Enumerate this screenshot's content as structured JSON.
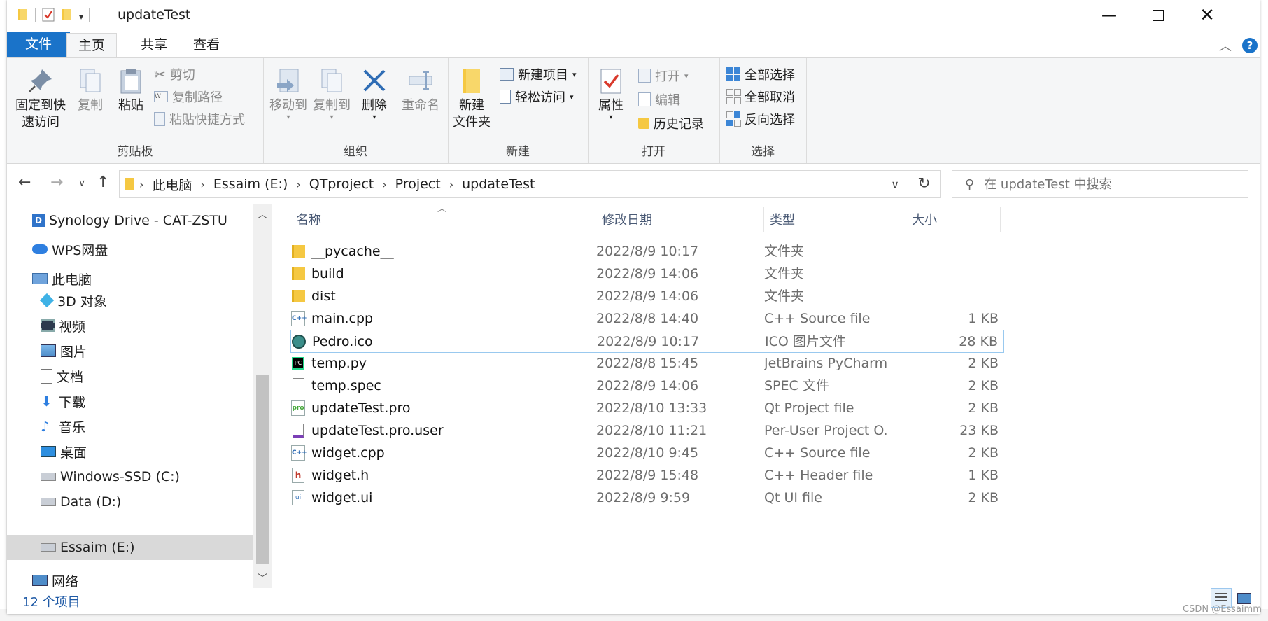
{
  "window": {
    "title": "updateTest"
  },
  "tabs": {
    "file": "文件",
    "home": "主页",
    "share": "共享",
    "view": "查看"
  },
  "ribbon": {
    "clipboard": {
      "pin": "固定到快\n速访问",
      "pin_l1": "固定到快",
      "pin_l2": "速访问",
      "copy": "复制",
      "paste": "粘贴",
      "cut": "剪切",
      "copy_path": "复制路径",
      "paste_shortcut": "粘贴快捷方式",
      "label": "剪贴板"
    },
    "organize": {
      "move_to": "移动到",
      "copy_to": "复制到",
      "delete": "删除",
      "rename": "重命名",
      "label": "组织"
    },
    "new": {
      "new_folder_l1": "新建",
      "new_folder_l2": "文件夹",
      "new_item": "新建项目",
      "easy_access": "轻松访问",
      "label": "新建"
    },
    "open": {
      "properties": "属性",
      "open": "打开",
      "edit": "编辑",
      "history": "历史记录",
      "label": "打开"
    },
    "select": {
      "select_all": "全部选择",
      "select_none": "全部取消",
      "invert": "反向选择",
      "label": "选择"
    }
  },
  "address": {
    "crumbs": [
      "此电脑",
      "Essaim (E:)",
      "QTproject",
      "Project",
      "updateTest"
    ],
    "search_placeholder": "在 updateTest 中搜索"
  },
  "nav": {
    "items": [
      {
        "label": "Synology Drive - CAT-ZSTU",
        "icon": "synology-drive-icon"
      },
      {
        "label": "WPS网盘",
        "icon": "cloud-icon"
      },
      {
        "label": "此电脑",
        "icon": "computer-icon"
      },
      {
        "label": "3D 对象",
        "icon": "cube-3d-icon"
      },
      {
        "label": "视频",
        "icon": "video-icon"
      },
      {
        "label": "图片",
        "icon": "picture-icon"
      },
      {
        "label": "文档",
        "icon": "document-icon"
      },
      {
        "label": "下载",
        "icon": "download-icon"
      },
      {
        "label": "音乐",
        "icon": "music-icon"
      },
      {
        "label": "桌面",
        "icon": "desktop-icon"
      },
      {
        "label": "Windows-SSD (C:)",
        "icon": "windows-drive-icon"
      },
      {
        "label": "Data (D:)",
        "icon": "drive-icon"
      },
      {
        "label": "Essaim (E:)",
        "icon": "drive-icon"
      },
      {
        "label": "网络",
        "icon": "network-icon"
      }
    ],
    "selected": "Essaim (E:)"
  },
  "columns": {
    "name": "名称",
    "date": "修改日期",
    "type": "类型",
    "size": "大小"
  },
  "files": [
    {
      "name": "__pycache__",
      "date": "2022/8/9 10:17",
      "type": "文件夹",
      "size": "",
      "icon": "folder-icon"
    },
    {
      "name": "build",
      "date": "2022/8/9 14:06",
      "type": "文件夹",
      "size": "",
      "icon": "folder-icon"
    },
    {
      "name": "dist",
      "date": "2022/8/9 14:06",
      "type": "文件夹",
      "size": "",
      "icon": "folder-icon"
    },
    {
      "name": "main.cpp",
      "date": "2022/8/8 14:40",
      "type": "C++ Source file",
      "size": "1 KB",
      "icon": "cpp-file-icon"
    },
    {
      "name": "Pedro.ico",
      "date": "2022/8/9 10:17",
      "type": "ICO 图片文件",
      "size": "28 KB",
      "icon": "ico-file-icon"
    },
    {
      "name": "temp.py",
      "date": "2022/8/8 15:45",
      "type": "JetBrains PyCharm ...",
      "size": "2 KB",
      "icon": "pycharm-file-icon"
    },
    {
      "name": "temp.spec",
      "date": "2022/8/9 14:06",
      "type": "SPEC 文件",
      "size": "2 KB",
      "icon": "blank-file-icon"
    },
    {
      "name": "updateTest.pro",
      "date": "2022/8/10 13:33",
      "type": "Qt Project file",
      "size": "2 KB",
      "icon": "qt-pro-file-icon"
    },
    {
      "name": "updateTest.pro.user",
      "date": "2022/8/10 11:21",
      "type": "Per-User Project O...",
      "size": "23 KB",
      "icon": "vs-user-file-icon"
    },
    {
      "name": "widget.cpp",
      "date": "2022/8/10 9:45",
      "type": "C++ Source file",
      "size": "2 KB",
      "icon": "cpp-file-icon"
    },
    {
      "name": "widget.h",
      "date": "2022/8/9 15:48",
      "type": "C++ Header file",
      "size": "1 KB",
      "icon": "header-file-icon"
    },
    {
      "name": "widget.ui",
      "date": "2022/8/9 9:59",
      "type": "Qt UI file",
      "size": "2 KB",
      "icon": "qt-ui-file-icon"
    }
  ],
  "status": {
    "count": "12 个项目"
  },
  "watermark": "CSDN @Essaimm",
  "colors": {
    "accent": "#1a73c9",
    "hover_border": "#99c9ef",
    "selected_nav": "#d9d9d9"
  }
}
